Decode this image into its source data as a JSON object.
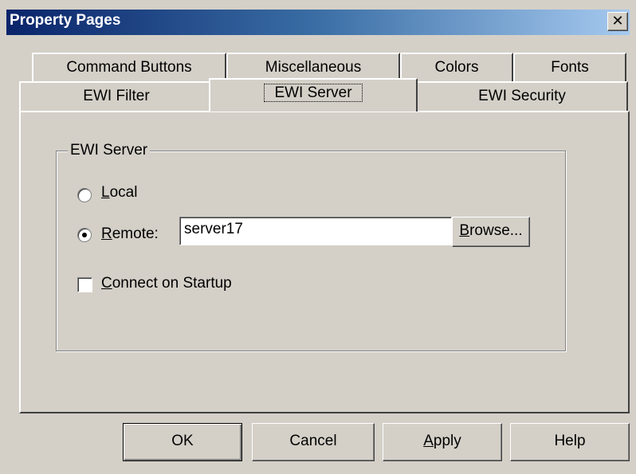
{
  "window": {
    "title": "Property Pages",
    "close_glyph": "✕"
  },
  "tabs": {
    "row1": [
      "Command Buttons",
      "Miscellaneous",
      "Colors",
      "Fonts"
    ],
    "row2": [
      "EWI Filter",
      "EWI Server",
      "EWI Security"
    ],
    "selected": "EWI Server"
  },
  "group": {
    "title": "EWI Server",
    "local": {
      "label_prefix": "",
      "label_mnemonic": "L",
      "label_rest": "ocal",
      "selected": false
    },
    "remote": {
      "label_mnemonic": "R",
      "label_rest": "emote:",
      "selected": true,
      "value": "server17"
    },
    "browse": {
      "mnemonic": "B",
      "rest": "rowse..."
    },
    "connect": {
      "mnemonic": "C",
      "rest": "onnect on Startup",
      "checked": false
    }
  },
  "buttons": {
    "ok": "OK",
    "cancel": "Cancel",
    "apply_mnemonic": "A",
    "apply_rest": "pply",
    "help": "Help"
  }
}
